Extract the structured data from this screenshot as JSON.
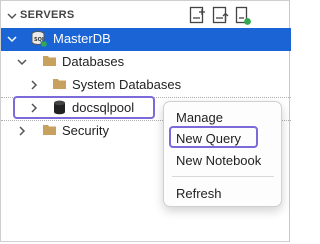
{
  "panel": {
    "title": "SERVERS"
  },
  "tree": {
    "server": "MasterDB",
    "databases": "Databases",
    "system_databases": "System Databases",
    "pool": "docsqlpool",
    "security": "Security"
  },
  "context_menu": {
    "items": [
      "Manage",
      "New Query",
      "New Notebook",
      "Refresh"
    ]
  },
  "colors": {
    "selection": "#1a64d6",
    "highlight_box": "#7b6bd9",
    "folder": "#c9a15e",
    "status_green": "#33a852"
  },
  "icons": {
    "collapse": "chevron-down-icon",
    "new_connection": "new-connection-icon",
    "new_server_group": "new-server-group-icon",
    "active_connections": "active-connections-icon",
    "folder": "folder-icon",
    "database": "database-icon",
    "server": "server-icon"
  }
}
